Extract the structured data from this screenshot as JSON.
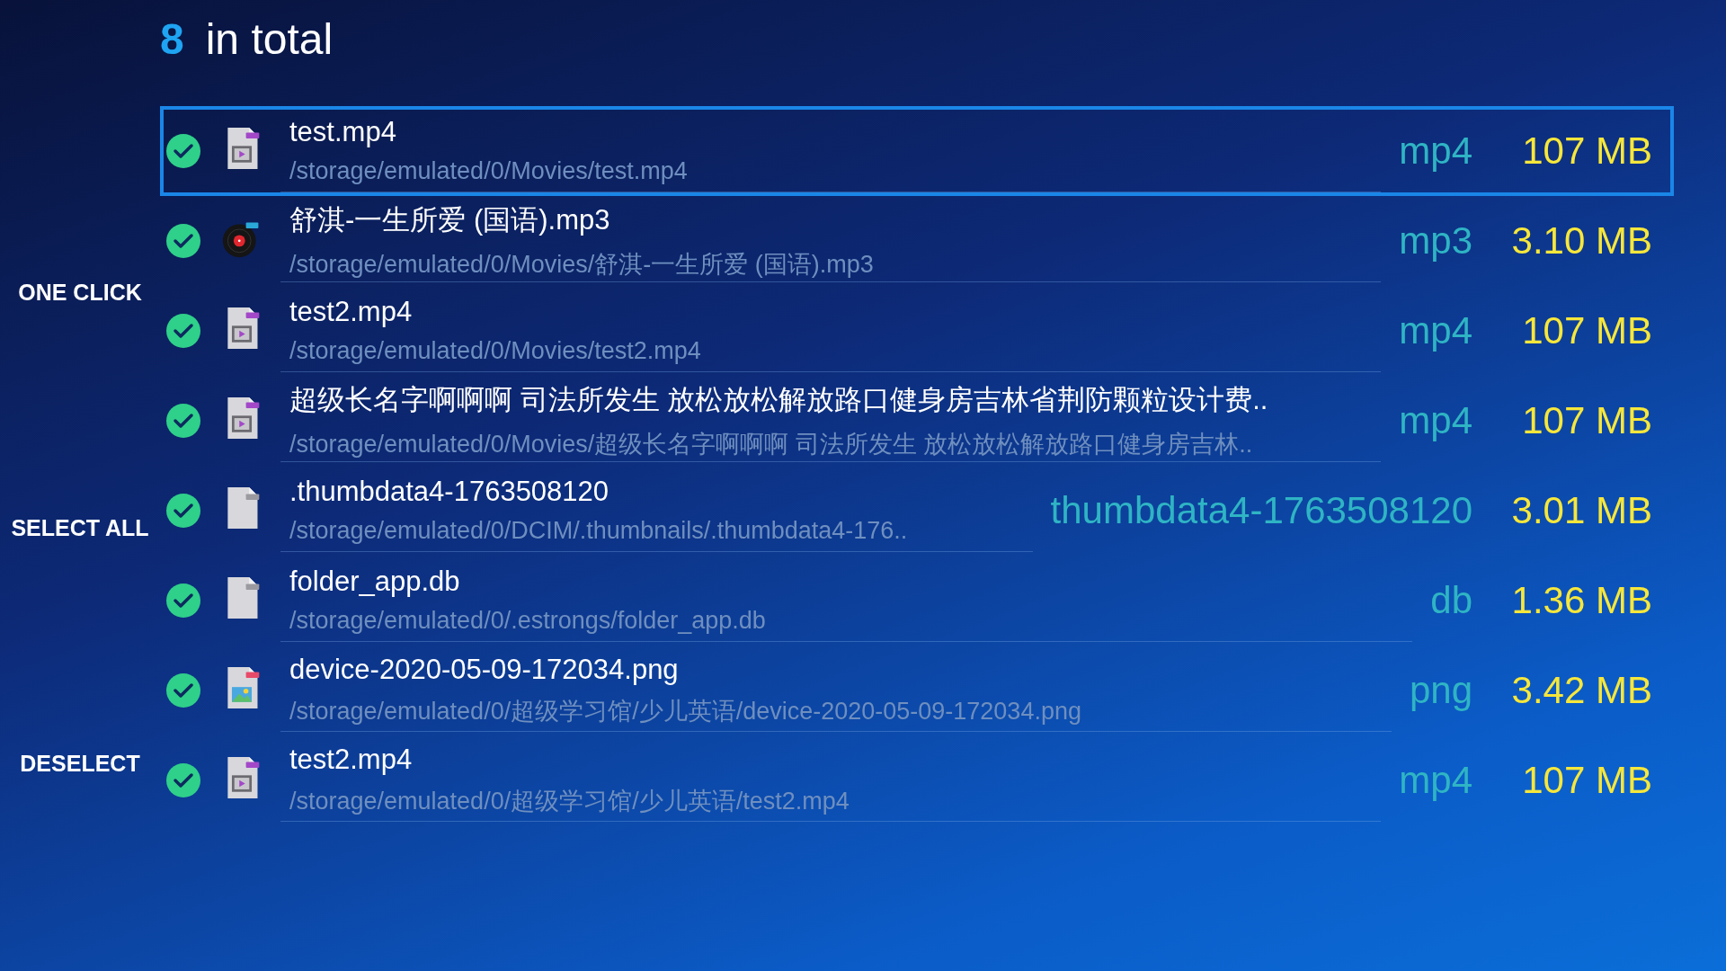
{
  "header": {
    "count": "8",
    "label": "in total"
  },
  "actions": [
    "ONE CLICK",
    "SELECT ALL",
    "DESELECT"
  ],
  "files": [
    {
      "name": "test.mp4",
      "path": "/storage/emulated/0/Movies/test.mp4",
      "type": "mp4",
      "size": "107 MB",
      "kind": "video",
      "checked": true,
      "selected": true
    },
    {
      "name": "舒淇-一生所爱 (国语).mp3",
      "path": "/storage/emulated/0/Movies/舒淇-一生所爱 (国语).mp3",
      "type": "mp3",
      "size": "3.10 MB",
      "kind": "audio",
      "checked": true,
      "selected": false
    },
    {
      "name": "test2.mp4",
      "path": "/storage/emulated/0/Movies/test2.mp4",
      "type": "mp4",
      "size": "107 MB",
      "kind": "video",
      "checked": true,
      "selected": false
    },
    {
      "name": "超级长名字啊啊啊 司法所发生 放松放松解放路口健身房吉林省荆防颗粒设计费..",
      "path": "/storage/emulated/0/Movies/超级长名字啊啊啊 司法所发生 放松放松解放路口健身房吉林..",
      "type": "mp4",
      "size": "107 MB",
      "kind": "video",
      "checked": true,
      "selected": false
    },
    {
      "name": ".thumbdata4-1763508120",
      "path": "/storage/emulated/0/DCIM/.thumbnails/.thumbdata4-176..",
      "type": "thumbdata4-1763508120",
      "size": "3.01 MB",
      "kind": "file",
      "checked": true,
      "selected": false
    },
    {
      "name": "folder_app.db",
      "path": "/storage/emulated/0/.estrongs/folder_app.db",
      "type": "db",
      "size": "1.36 MB",
      "kind": "file",
      "checked": true,
      "selected": false
    },
    {
      "name": "device-2020-05-09-172034.png",
      "path": "/storage/emulated/0/超级学习馆/少儿英语/device-2020-05-09-172034.png",
      "type": "png",
      "size": "3.42 MB",
      "kind": "image",
      "checked": true,
      "selected": false
    },
    {
      "name": "test2.mp4",
      "path": "/storage/emulated/0/超级学习馆/少儿英语/test2.mp4",
      "type": "mp4",
      "size": "107 MB",
      "kind": "video",
      "checked": true,
      "selected": false
    }
  ]
}
